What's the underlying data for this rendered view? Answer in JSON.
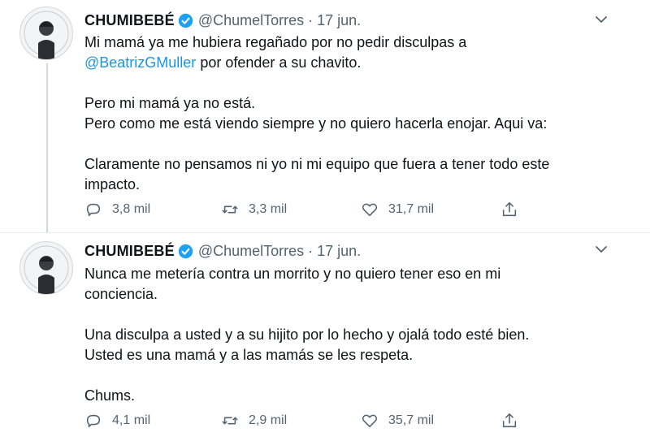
{
  "tweets": [
    {
      "name": "CHUMIBEBÉ",
      "handle": "@ChumelTorres",
      "separator": "·",
      "date": "17 jun.",
      "lines": {
        "l1": "Mi mamá ya me hubiera regañado por no pedir disculpas a",
        "mention": "@BeatrizGMuller",
        "l2_rest": " por ofender a su chavito.",
        "l3": "Pero mi mamá ya no está.",
        "l4": "Pero como me está viendo siempre y no quiero hacerla enojar. Aqui va:",
        "l5": "Claramente no pensamos ni yo ni mi equipo que fuera a tener todo este",
        "l6": "impacto."
      },
      "replies": "3,8 mil",
      "retweets": "3,3 mil",
      "likes": "31,7 mil"
    },
    {
      "name": "CHUMIBEBÉ",
      "handle": "@ChumelTorres",
      "separator": "·",
      "date": "17 jun.",
      "lines": {
        "l1": "Nunca me metería contra un morrito y no quiero tener eso en mi",
        "l2": "conciencia.",
        "l3": "Una disculpa a usted y a su hijito por lo hecho y ojalá todo esté bien.",
        "l4": "Usted es una mamá y a las mamás se les respeta.",
        "l5": "Chums."
      },
      "replies": "4,1 mil",
      "retweets": "2,9 mil",
      "likes": "35,7 mil"
    }
  ],
  "icons": {
    "verified": "verified-badge-icon",
    "caret": "chevron-down-icon",
    "reply": "reply-icon",
    "retweet": "retweet-icon",
    "like": "heart-icon",
    "share": "share-icon"
  },
  "colors": {
    "accent": "#1b95e0",
    "text": "#0f1419",
    "secondary": "#536471",
    "verified": "#1da1f2"
  }
}
